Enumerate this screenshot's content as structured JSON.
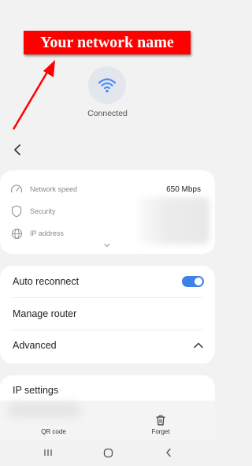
{
  "annotation": {
    "text": "Your network name",
    "color": "#ff0000"
  },
  "header": {
    "status": "Connected",
    "icon": "wifi-icon",
    "back_icon": "chevron-left-icon"
  },
  "network_info": {
    "rows": [
      {
        "label": "Network speed",
        "value": "650 Mbps",
        "icon": "speed-gauge-icon"
      },
      {
        "label": "Security",
        "value": "",
        "icon": "shield-icon"
      },
      {
        "label": "IP address",
        "value": "",
        "icon": "globe-icon"
      }
    ],
    "expand_icon": "chevron-down-icon"
  },
  "settings": {
    "auto_reconnect": {
      "label": "Auto reconnect",
      "enabled": true
    },
    "manage_router": {
      "label": "Manage router"
    },
    "advanced": {
      "label": "Advanced",
      "expanded": true
    },
    "ip_settings": {
      "label": "IP settings"
    }
  },
  "bottom_actions": [
    {
      "label": "QR code",
      "icon": "qr-code-icon"
    },
    {
      "label": "Forget",
      "icon": "trash-icon"
    }
  ],
  "nav_bar": {
    "recent_icon": "recent-apps-icon",
    "home_icon": "home-icon",
    "back_icon": "back-icon"
  },
  "colors": {
    "accent": "#3e82e6",
    "background": "#f2f2f2",
    "card": "#ffffff"
  }
}
